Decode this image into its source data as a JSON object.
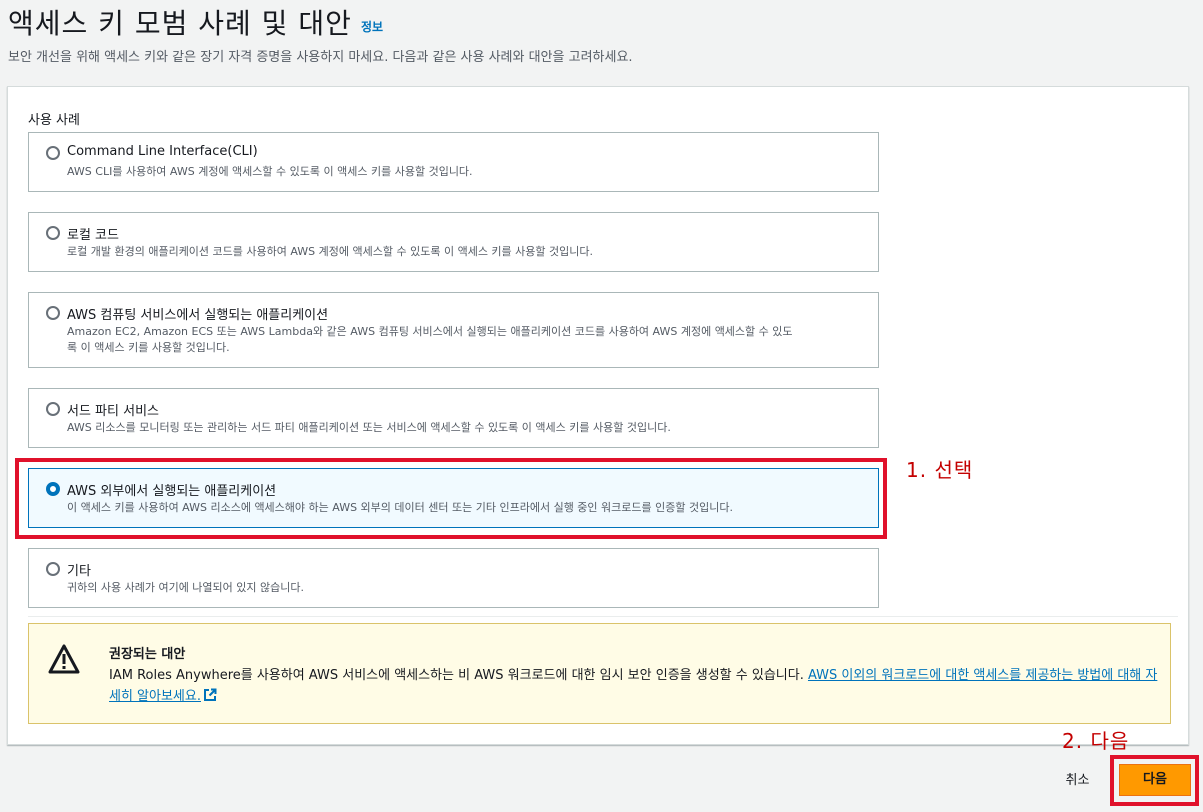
{
  "header": {
    "title": "액세스 키 모범 사례 및 대안",
    "info_label": "정보",
    "subtitle": "보안 개선을 위해 액세스 키와 같은 장기 자격 증명을 사용하지 마세요. 다음과 같은 사용 사례와 대안을 고려하세요."
  },
  "use_case": {
    "label": "사용 사례",
    "selected_index": 4,
    "options": [
      {
        "title": "Command Line Interface(CLI)",
        "description": "AWS CLI를 사용하여 AWS 계정에 액세스할 수 있도록 이 액세스 키를 사용할 것입니다."
      },
      {
        "title": "로컬 코드",
        "description": "로컬 개발 환경의 애플리케이션 코드를 사용하여 AWS 계정에 액세스할 수 있도록 이 액세스 키를 사용할 것입니다."
      },
      {
        "title": "AWS 컴퓨팅 서비스에서 실행되는 애플리케이션",
        "description_line1": "Amazon EC2, Amazon ECS 또는 AWS Lambda와 같은 AWS 컴퓨팅 서비스에서 실행되는 애플리케이션 코드를 사용하여 AWS 계정에 액세스할 수 있도",
        "description_line2": "록 이 액세스 키를 사용할 것입니다."
      },
      {
        "title": "서드 파티 서비스",
        "description": "AWS 리소스를 모니터링 또는 관리하는 서드 파티 애플리케이션 또는 서비스에 액세스할 수 있도록 이 액세스 키를 사용할 것입니다."
      },
      {
        "title": "AWS 외부에서 실행되는 애플리케이션",
        "description": "이 액세스 키를 사용하여 AWS 리소스에 액세스해야 하는 AWS 외부의 데이터 센터 또는 기타 인프라에서 실행 중인 워크로드를 인증할 것입니다."
      },
      {
        "title": "기타",
        "description": "귀하의 사용 사례가 여기에 나열되어 있지 않습니다."
      }
    ]
  },
  "alert": {
    "icon": "warning-triangle-icon",
    "title": "권장되는 대안",
    "body": "IAM Roles Anywhere를 사용하여 AWS 서비스에 액세스하는 비 AWS 워크로드에 대한 임시 보안 인증을 생성할 수 있습니다. ",
    "link_text": "AWS 이외의 워크로드에 대한 액세스를 제공하는 방법에 대해 자세히 알아보세요."
  },
  "annotations": {
    "step1": "1. 선택",
    "step2": "2. 다음"
  },
  "footer": {
    "cancel_label": "취소",
    "next_label": "다음"
  },
  "colors": {
    "accent": "#0073bb",
    "primary_button": "#ff9900",
    "warning_bg": "#fffce6",
    "annotation_red": "#e0112b"
  }
}
